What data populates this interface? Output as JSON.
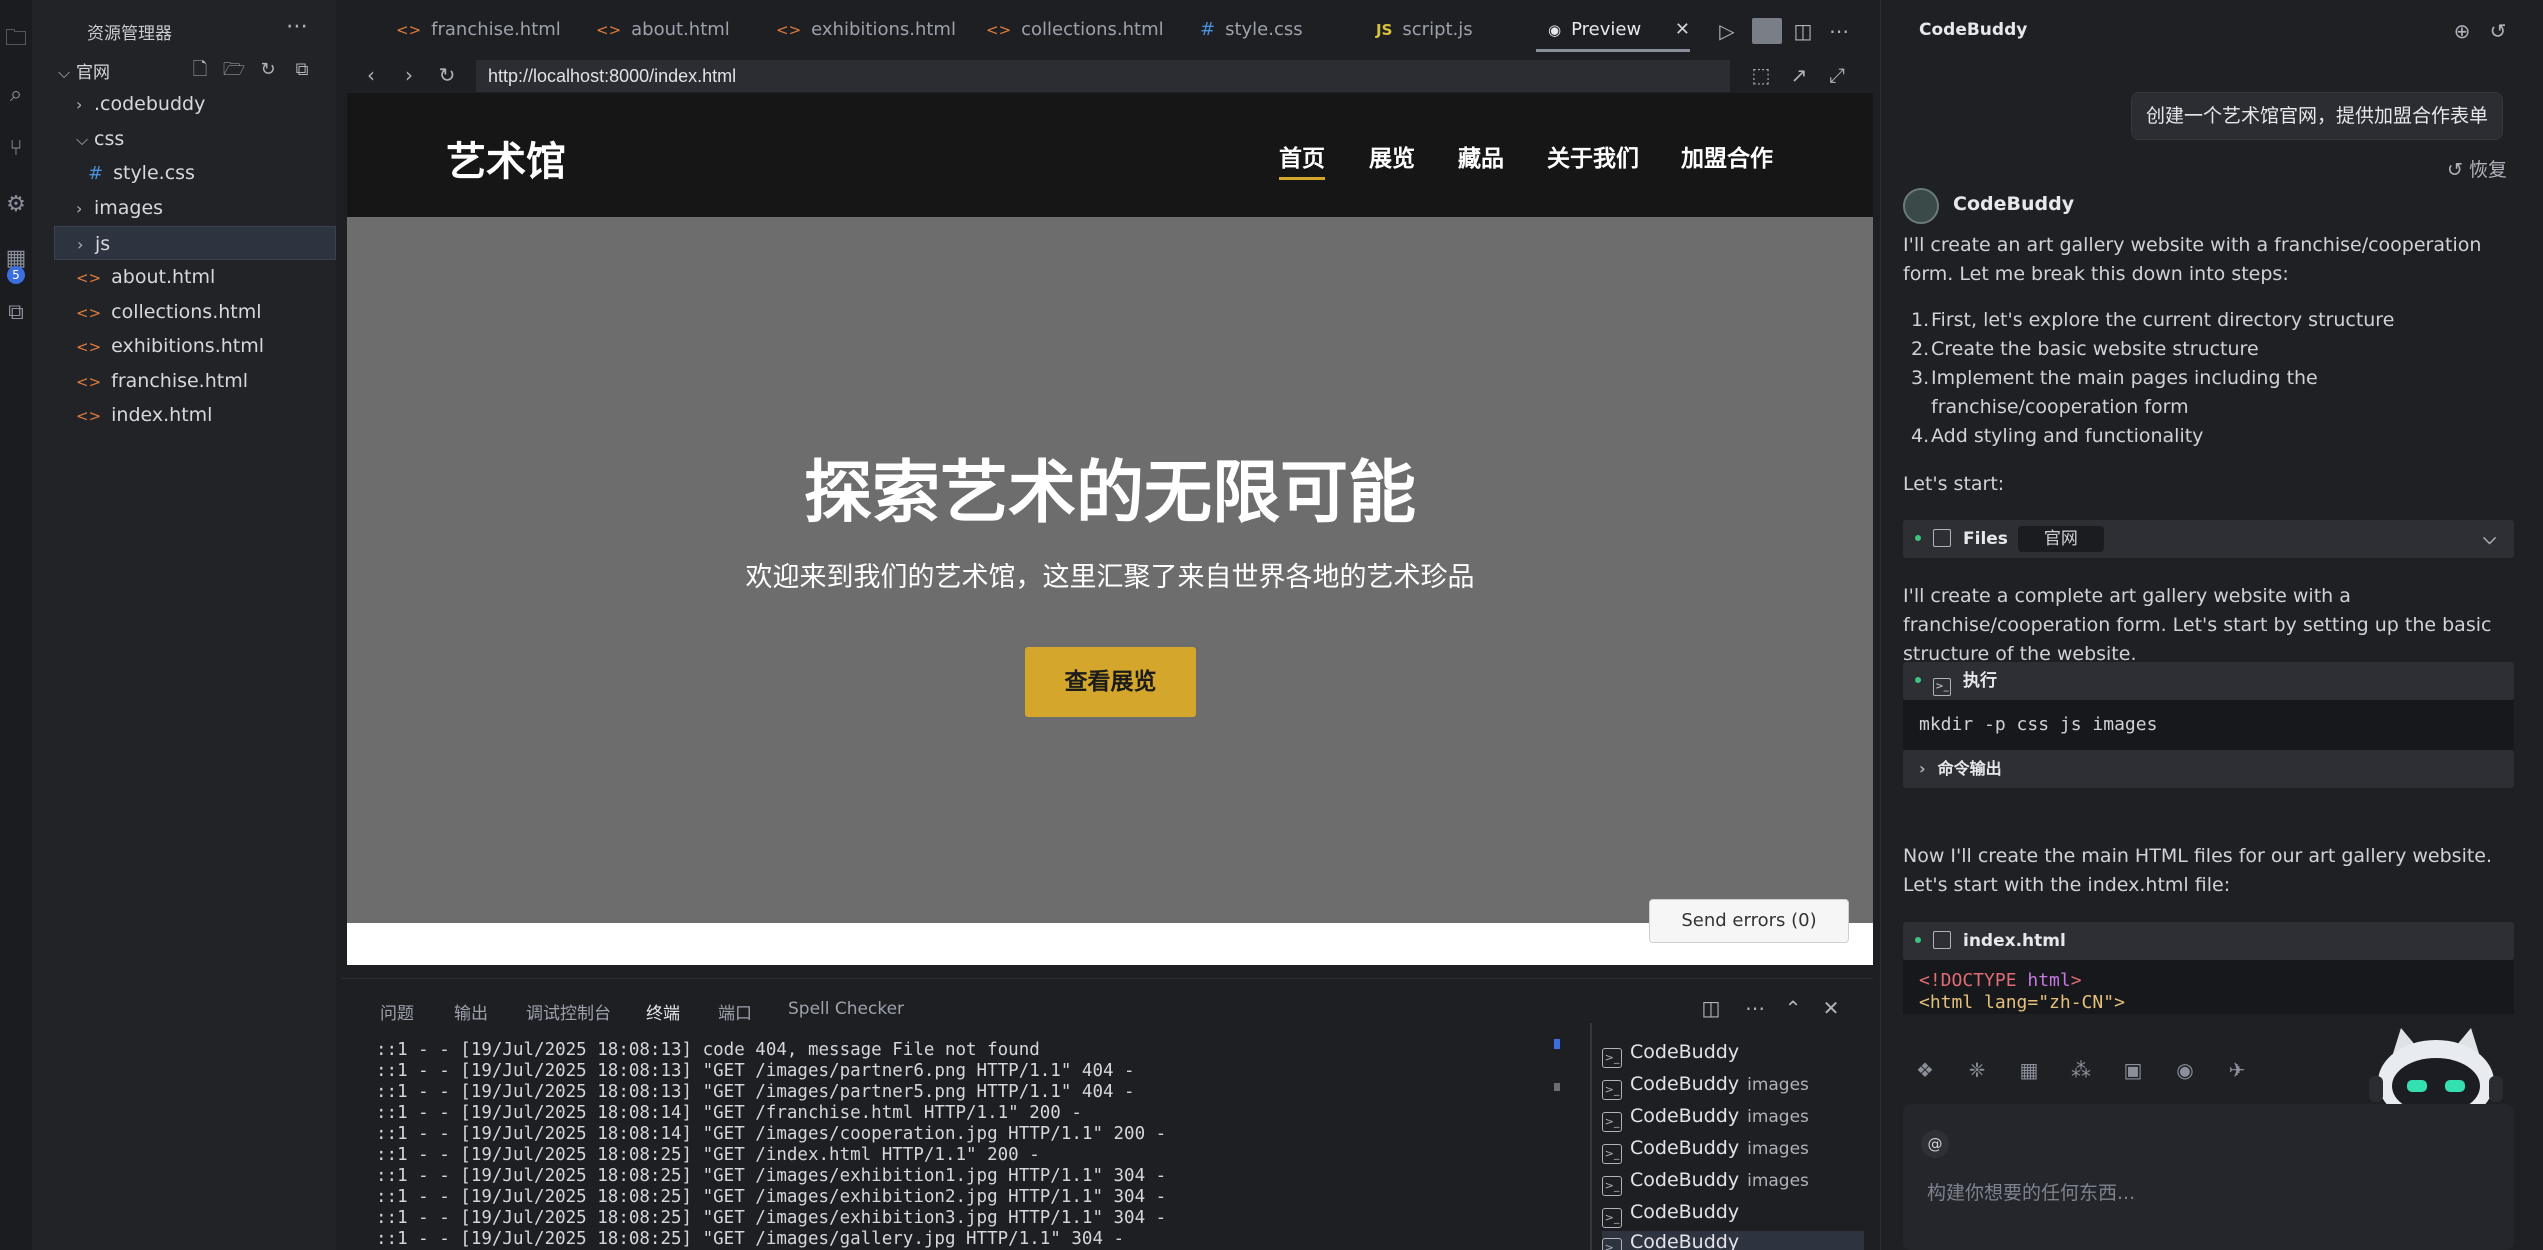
{
  "explorer": {
    "title": "资源管理器",
    "root": "官网",
    "items": [
      {
        "label": ".codebuddy",
        "kind": "folder"
      },
      {
        "label": "css",
        "kind": "folder-open"
      },
      {
        "label": "style.css",
        "kind": "css"
      },
      {
        "label": "images",
        "kind": "folder"
      },
      {
        "label": "js",
        "kind": "folder"
      },
      {
        "label": "about.html",
        "kind": "html"
      },
      {
        "label": "collections.html",
        "kind": "html"
      },
      {
        "label": "exhibitions.html",
        "kind": "html"
      },
      {
        "label": "franchise.html",
        "kind": "html"
      },
      {
        "label": "index.html",
        "kind": "html"
      }
    ]
  },
  "activity_badge": "5",
  "tabs": [
    {
      "label": "franchise.html",
      "icon": "<>"
    },
    {
      "label": "about.html",
      "icon": "<>"
    },
    {
      "label": "exhibitions.html",
      "icon": "<>"
    },
    {
      "label": "collections.html",
      "icon": "<>"
    },
    {
      "label": "style.css",
      "icon": "#"
    },
    {
      "label": "script.js",
      "icon": "JS"
    },
    {
      "label": "Preview",
      "icon": "eye"
    }
  ],
  "url": "http://localhost:8000/index.html",
  "site": {
    "logo": "艺术馆",
    "nav": [
      "首页",
      "展览",
      "藏品",
      "关于我们",
      "加盟合作"
    ],
    "hero_title": "探索艺术的无限可能",
    "hero_subtitle": "欢迎来到我们的艺术馆，这里汇聚了来自世界各地的艺术珍品",
    "hero_button": "查看展览",
    "colors": {
      "accent": "#d4a72c",
      "header": "#161616",
      "hero": "#6d6d6d"
    }
  },
  "send_errors": "Send errors (0)",
  "panel": {
    "tabs": [
      "问题",
      "输出",
      "调试控制台",
      "终端",
      "端口",
      "Spell Checker"
    ],
    "terminal_lines": [
      "::1 - - [19/Jul/2025 18:08:13] code 404, message File not found",
      "::1 - - [19/Jul/2025 18:08:13] \"GET /images/partner6.png HTTP/1.1\" 404 -",
      "::1 - - [19/Jul/2025 18:08:13] \"GET /images/partner5.png HTTP/1.1\" 404 -",
      "::1 - - [19/Jul/2025 18:08:14] \"GET /franchise.html HTTP/1.1\" 200 -",
      "::1 - - [19/Jul/2025 18:08:14] \"GET /images/cooperation.jpg HTTP/1.1\" 200 -",
      "::1 - - [19/Jul/2025 18:08:25] \"GET /index.html HTTP/1.1\" 200 -",
      "::1 - - [19/Jul/2025 18:08:25] \"GET /images/exhibition1.jpg HTTP/1.1\" 304 -",
      "::1 - - [19/Jul/2025 18:08:25] \"GET /images/exhibition2.jpg HTTP/1.1\" 304 -",
      "::1 - - [19/Jul/2025 18:08:25] \"GET /images/exhibition3.jpg HTTP/1.1\" 304 -",
      "::1 - - [19/Jul/2025 18:08:25] \"GET /images/gallery.jpg HTTP/1.1\" 304 -"
    ],
    "terminals": [
      {
        "name": "CodeBuddy",
        "sub": ""
      },
      {
        "name": "CodeBuddy",
        "sub": "images"
      },
      {
        "name": "CodeBuddy",
        "sub": "images"
      },
      {
        "name": "CodeBuddy",
        "sub": "images"
      },
      {
        "name": "CodeBuddy",
        "sub": "images"
      },
      {
        "name": "CodeBuddy",
        "sub": ""
      },
      {
        "name": "CodeBuddy",
        "sub": ""
      }
    ]
  },
  "chat": {
    "title": "CodeBuddy",
    "user_message": "创建一个艺术馆官网，提供加盟合作表单",
    "restore": "恢复",
    "bot_name": "CodeBuddy",
    "intro": "I'll create an art gallery website with a franchise/cooperation form. Let me break this down into steps:",
    "steps": [
      "First, let's explore the current directory structure",
      "Create the basic website structure",
      "Implement the main pages including the franchise/cooperation form",
      "Add styling and functionality"
    ],
    "lets_start": "Let's start:",
    "files_label": "Files",
    "files_tag": "官网",
    "para2": "I'll create a complete art gallery website with a franchise/cooperation form. Let's start by setting up the basic structure of the website.",
    "exec_label": "执行",
    "exec_command": "mkdir -p css js images",
    "cmd_output": "命令输出",
    "para3": "Now I'll create the main HTML files for our art gallery website. Let's start with the index.html file:",
    "file_label": "index.html",
    "code_line1_a": "<!DOCTYPE ",
    "code_line1_b": "html",
    "code_line1_c": ">",
    "code_line2": "<html lang=\"zh-CN\">",
    "input_placeholder": "构建你想要的任何东西...",
    "at": "@"
  }
}
